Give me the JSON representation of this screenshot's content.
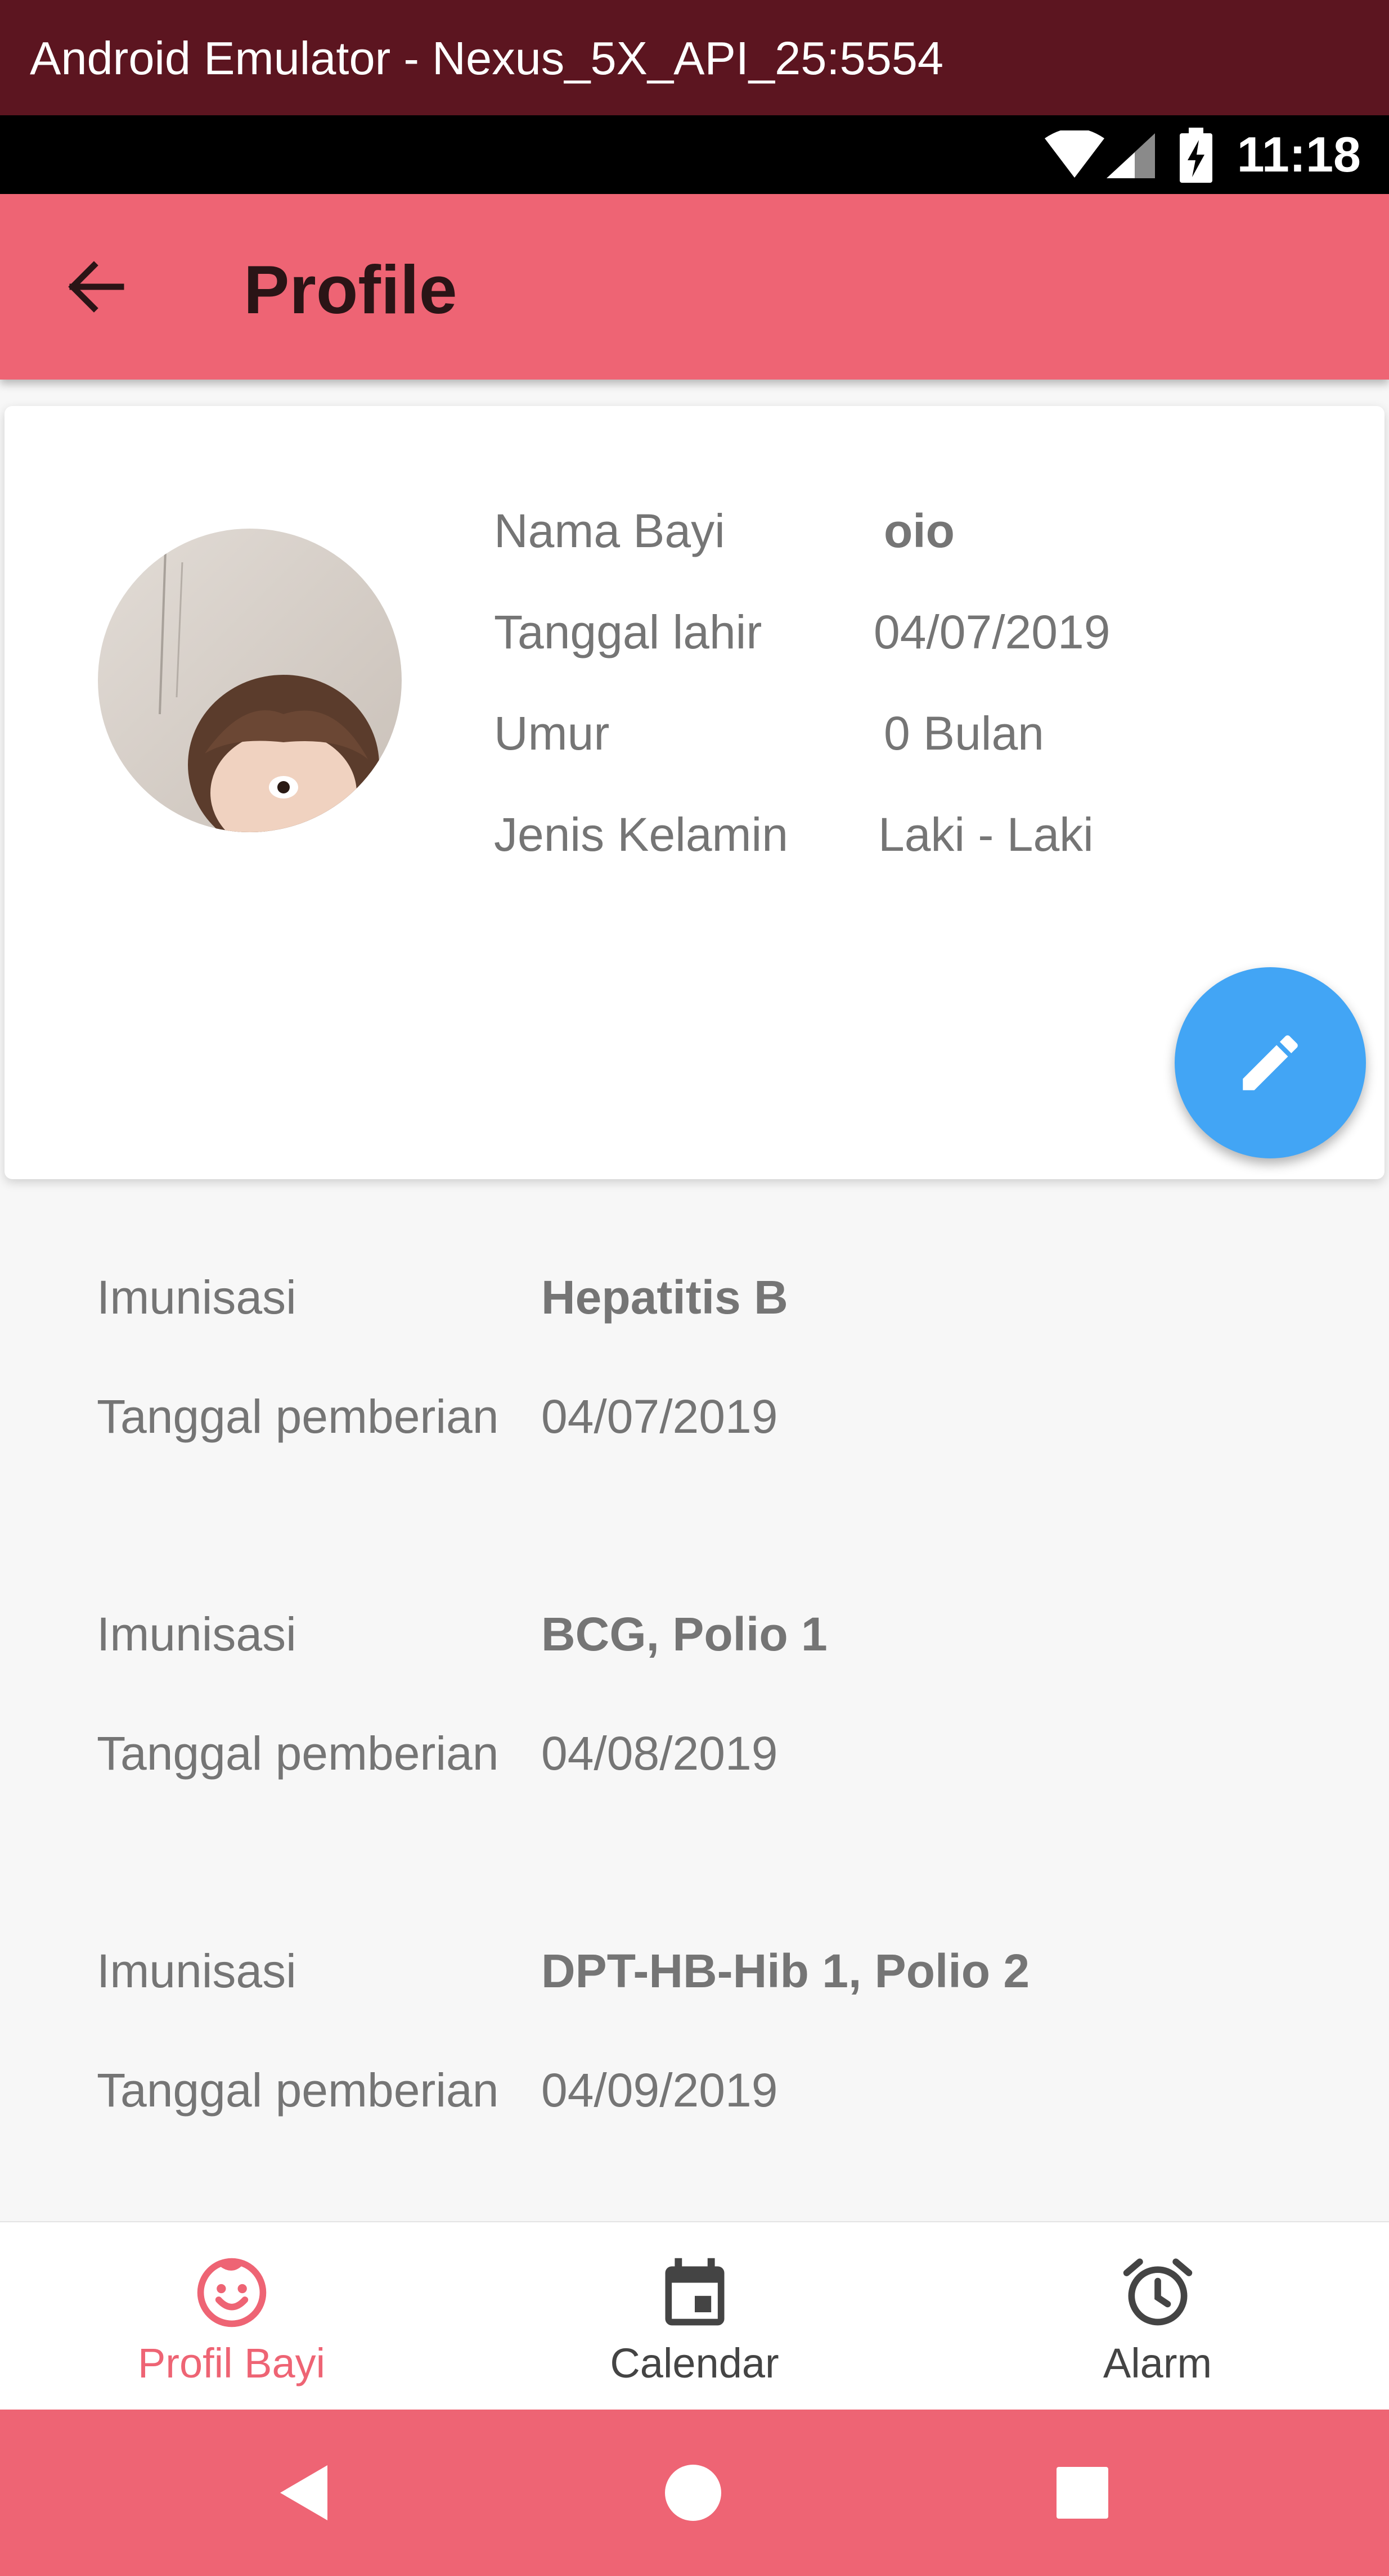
{
  "window": {
    "title": "Android Emulator - Nexus_5X_API_25:5554"
  },
  "status_bar": {
    "time": "11:18",
    "icons": [
      "wifi-icon",
      "cell-signal-icon",
      "battery-charging-icon"
    ]
  },
  "app_bar": {
    "title": "Profile",
    "back_icon": "arrow-back-icon",
    "color": "#ee6474"
  },
  "profile": {
    "photo_icon": "baby-photo",
    "rows": [
      {
        "label": "Nama Bayi",
        "value": "oio"
      },
      {
        "label": "Tanggal lahir",
        "value": "04/07/2019"
      },
      {
        "label": "Umur",
        "value": "0 Bulan"
      },
      {
        "label": "Jenis Kelamin",
        "value": "Laki - Laki"
      }
    ],
    "edit_icon": "pencil-icon",
    "fab_color": "#42a5f5"
  },
  "immunizations": [
    {
      "imm_label": "Imunisasi",
      "imm_value": "Hepatitis B",
      "date_label": "Tanggal pemberian",
      "date_value": "04/07/2019"
    },
    {
      "imm_label": "Imunisasi",
      "imm_value": "BCG, Polio 1",
      "date_label": "Tanggal pemberian",
      "date_value": "04/08/2019"
    },
    {
      "imm_label": "Imunisasi",
      "imm_value": "DPT-HB-Hib 1, Polio 2",
      "date_label": "Tanggal pemberian",
      "date_value": "04/09/2019"
    }
  ],
  "bottom_nav": {
    "items": [
      {
        "label": "Profil Bayi",
        "icon": "baby-face-icon",
        "active": true
      },
      {
        "label": "Calendar",
        "icon": "calendar-icon",
        "active": false
      },
      {
        "label": "Alarm",
        "icon": "alarm-clock-icon",
        "active": false
      }
    ],
    "active_color": "#ee6474",
    "inactive_color": "#444444"
  },
  "system_nav": {
    "buttons": [
      "back-triangle-icon",
      "home-circle-icon",
      "recents-square-icon"
    ]
  }
}
